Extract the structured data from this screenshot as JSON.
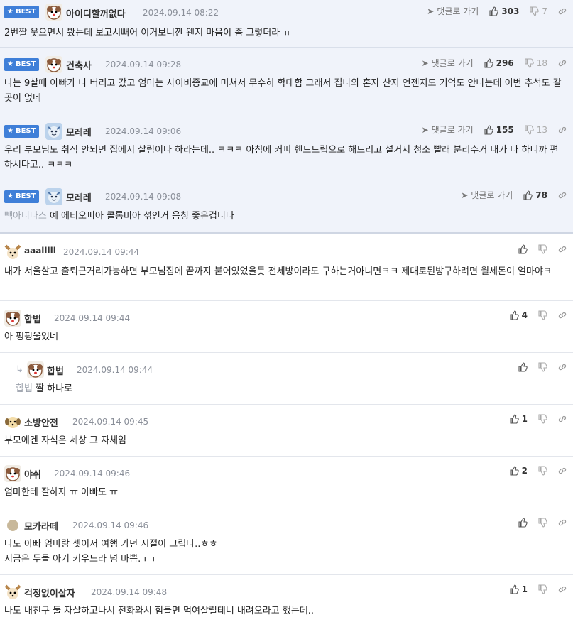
{
  "ui": {
    "best_label": "BEST",
    "reply_link_label": "댓글로 가기"
  },
  "best_comments": [
    {
      "nickname": "아이디할꺼없다",
      "date": "2024.09.14 08:22",
      "up": "303",
      "down": "7",
      "text": "2번짤 웃으면서 봤는데 보고시뻐어 이거보니깐 왠지 마음이 좀 그렇더라 ㅠ"
    },
    {
      "nickname": "건축사",
      "date": "2024.09.14 09:28",
      "up": "296",
      "down": "18",
      "text": "나는 9살때 아빠가 나 버리고 갔고 엄마는 사이비종교에 미쳐서 무수히 학대함 그래서 집나와 혼자 산지 언젠지도 기억도 안나는데 이번 추석도 갈곳이 없네"
    },
    {
      "nickname": "모레레",
      "date": "2024.09.14 09:06",
      "up": "155",
      "down": "13",
      "text": "우리 부모님도 취직 안되면 집에서 살림이나 하라는데.. ㅋㅋㅋ 아침에 커피 핸드드립으로 해드리고 설거지 청소 빨래 분리수거 내가 다 하니까 편하시다고.. ㅋㅋㅋ"
    },
    {
      "nickname": "모레레",
      "date": "2024.09.14 09:08",
      "up": "78",
      "down": "",
      "mention": "빽아디다스",
      "text": "예 에티오피아 콜롬비아 섞인거 음칭 좋은겁니다"
    }
  ],
  "comments": [
    {
      "nickname": "aaalllll",
      "date": "2024.09.14 09:44",
      "up": "",
      "text": "내가 서울살고 출퇴근거리가능하면 부모님집에 끝까지 붙어있었을듯 전세방이라도 구하는거아니면ㅋㅋ 제대로된방구하려면 월세돈이 얼마야ㅋ"
    },
    {
      "nickname": "합법",
      "date": "2024.09.14 09:44",
      "up": "4",
      "text": "아 펑펑울었네"
    },
    {
      "nickname": "합법",
      "date": "2024.09.14 09:44",
      "up": "",
      "mention": "합법",
      "text": "짤 하나로"
    },
    {
      "nickname": "소방안전",
      "date": "2024.09.14 09:45",
      "up": "1",
      "text": "부모에겐 자식은 세상 그 자체임"
    },
    {
      "nickname": "야쉬",
      "date": "2024.09.14 09:46",
      "up": "2",
      "text": "엄마한테 잘하자 ㅠ 아빠도 ㅠ"
    },
    {
      "nickname": "모카라떼",
      "date": "2024.09.14 09:46",
      "up": "",
      "text_line1": "나도 아빠 엄마랑 셋이서 여행 가던 시절이 그립다..ㅎㅎ",
      "text_line2": "지금은 두돌 아기 키우느라 넘 바쁨.ㅜㅜ"
    },
    {
      "nickname": "걱정없이살자",
      "date": "2024.09.14 09:48",
      "up": "1",
      "text": "나도 내친구 둘 자살하고나서 전화와서 힘들면 먹여살릴테니 내려오라고 했는데.."
    }
  ]
}
